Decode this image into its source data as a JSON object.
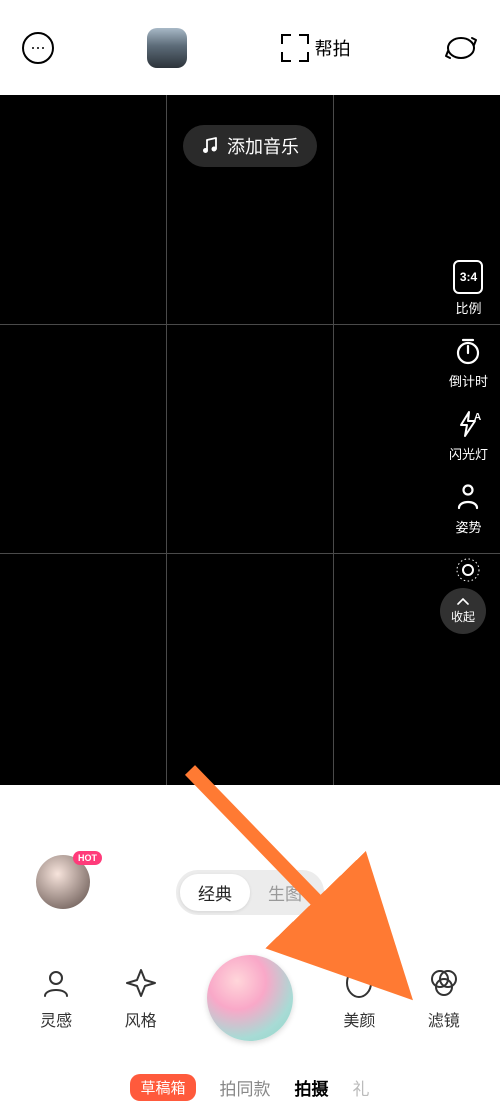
{
  "topbar": {
    "assist_label": "帮拍"
  },
  "viewfinder": {
    "music_label": "添加音乐"
  },
  "side": {
    "ratio_value": "3:4",
    "ratio_label": "比例",
    "timer_label": "倒计时",
    "flash_label": "闪光灯",
    "pose_label": "姿势",
    "collapse_label": "收起"
  },
  "bottom": {
    "avatar_badge": "HOT",
    "mode_classic": "经典",
    "mode_gen": "生图",
    "tools": {
      "inspire": "灵感",
      "style": "风格",
      "beauty": "美颜",
      "filter": "滤镜"
    },
    "tabs": {
      "draft": "草稿箱",
      "same": "拍同款",
      "shoot": "拍摄",
      "extra": "礼"
    }
  }
}
